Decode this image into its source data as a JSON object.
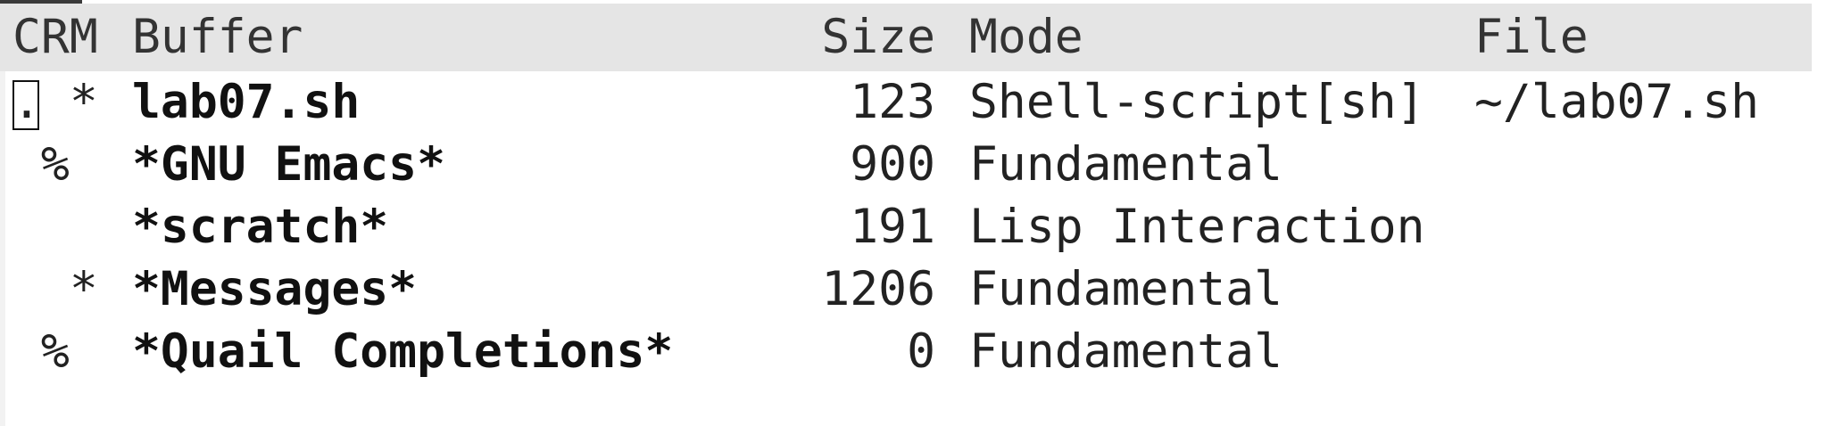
{
  "header": {
    "crm": "CRM",
    "buffer": "Buffer",
    "size": "Size",
    "mode": "Mode",
    "file": "File"
  },
  "rows": [
    {
      "crm": ". *",
      "buffer": "lab07.sh",
      "size": "123",
      "mode": "Shell-script[sh]",
      "file": "~/lab07.sh"
    },
    {
      "crm": " %",
      "buffer": "*GNU Emacs*",
      "size": "900",
      "mode": "Fundamental",
      "file": ""
    },
    {
      "crm": "",
      "buffer": "*scratch*",
      "size": "191",
      "mode": "Lisp Interaction",
      "file": ""
    },
    {
      "crm": "  *",
      "buffer": "*Messages*",
      "size": "1206",
      "mode": "Fundamental",
      "file": ""
    },
    {
      "crm": " %",
      "buffer": "*Quail Completions*",
      "size": "0",
      "mode": "Fundamental",
      "file": ""
    }
  ],
  "colors": {
    "header_bg": "#e5e5e5",
    "background": "#ffffff",
    "text": "#222222"
  }
}
